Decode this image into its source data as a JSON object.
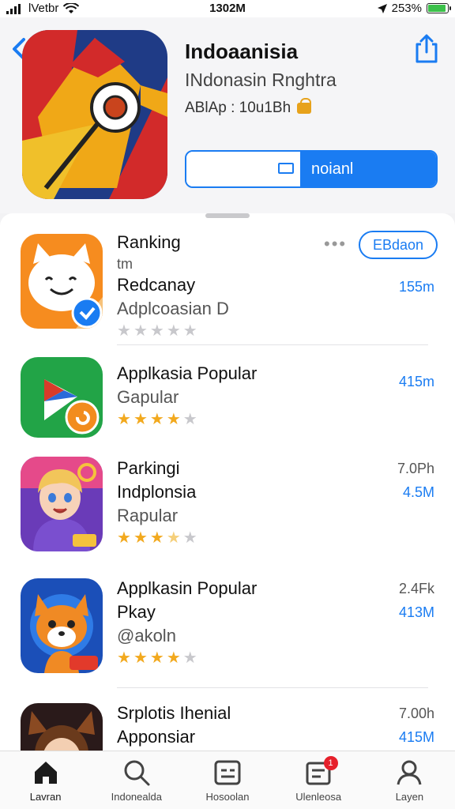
{
  "status": {
    "carrier": "lVetbr",
    "time": "1302M",
    "battery": "253%",
    "battery_level": 0.92
  },
  "app": {
    "title": "Indoaanisia",
    "subtitle": "INdonasin Rnghtra",
    "meta": "ABlAp : 10u1Bh",
    "install_label": "noianl"
  },
  "list": {
    "header_action": "EBdaon",
    "items": [
      {
        "line1": "Ranking",
        "line2": "tm",
        "line3": "Redcanay",
        "line4": "Adplcoasian D",
        "rating": 0,
        "size_line1": "",
        "size_line2": "155m"
      },
      {
        "line1": "Applkasia Popular",
        "line2": "Gapular",
        "line3": "",
        "line4": "",
        "rating": 4,
        "size_line1": "",
        "size_line2": "415m"
      },
      {
        "line1": "Parkingi",
        "line2": "Indplonsia",
        "line3": "Rapular",
        "line4": "",
        "rating": 3.5,
        "size_line1": "7.0Ph",
        "size_line2": "4.5M"
      },
      {
        "line1": "Applkasin Popular",
        "line2": "Pkay",
        "line3": "@akoln",
        "line4": "",
        "rating": 4,
        "size_line1": "2.4Fk",
        "size_line2": "413M"
      },
      {
        "line1": "Srplotis Ihenial",
        "line2": "Apponsiar",
        "line3": "",
        "line4": "",
        "rating": 0,
        "size_line1": "7.00h",
        "size_line2": "415M"
      }
    ]
  },
  "tabs": [
    {
      "label": "Lavran",
      "icon": "home-icon"
    },
    {
      "label": "Indonealda",
      "icon": "search-icon"
    },
    {
      "label": "Hosoolan",
      "icon": "apps-icon"
    },
    {
      "label": "Ulenleosa",
      "icon": "updates-icon",
      "badge": "1"
    },
    {
      "label": "Layen",
      "icon": "profile-icon"
    }
  ],
  "colors": {
    "accent": "#1a7cf2",
    "star": "#f2a91e",
    "star_empty": "#c8c8cc",
    "badge": "#e6202b"
  }
}
